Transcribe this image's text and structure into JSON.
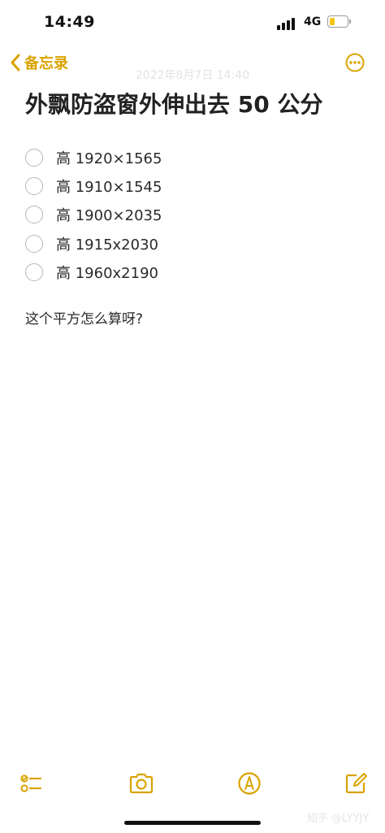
{
  "status": {
    "time": "14:49",
    "network": "4G",
    "battery_level": 0.3
  },
  "nav": {
    "back_label": "备忘录",
    "date": "2022年8月7日 14:40",
    "more_icon": "ellipsis-circle-icon"
  },
  "note": {
    "title": "外飘防盗窗外伸出去 50 公分",
    "checklist": [
      {
        "text": "高 1920×1565",
        "checked": false
      },
      {
        "text": "高 1910×1545",
        "checked": false
      },
      {
        "text": "高 1900×2035",
        "checked": false
      },
      {
        "text": "高 1915x2030",
        "checked": false
      },
      {
        "text": "高 1960x2190",
        "checked": false
      }
    ],
    "question": "这个平方怎么算呀?"
  },
  "toolbar": {
    "items": [
      "checklist-icon",
      "camera-icon",
      "markup-icon",
      "compose-icon"
    ]
  },
  "watermark": "知乎 @LYYJY",
  "colors": {
    "accent": "#d9a300",
    "battery_fill": "#f5c518",
    "text": "#222222",
    "background": "#ffffff"
  }
}
